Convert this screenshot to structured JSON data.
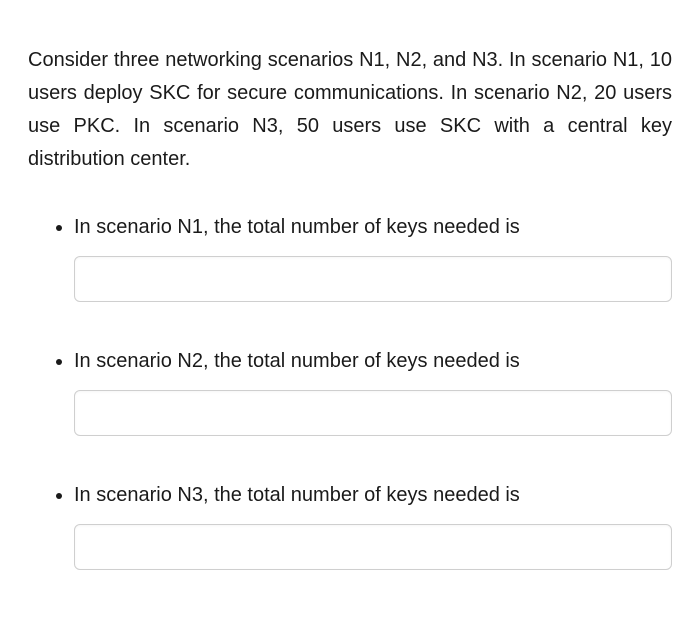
{
  "intro": "Consider three networking scenarios N1, N2, and N3. In scenario N1, 10 users deploy SKC for secure communications. In scenario N2, 20 users use PKC. In scenario N3, 50 users use SKC with a central key distribution center.",
  "questions": [
    {
      "label": "In scenario N1, the total number of keys needed is",
      "value": "",
      "placeholder": ""
    },
    {
      "label": "In scenario N2, the total number of keys needed is",
      "value": "",
      "placeholder": ""
    },
    {
      "label": "In scenario N3, the total number of keys needed is",
      "value": "",
      "placeholder": ""
    }
  ]
}
